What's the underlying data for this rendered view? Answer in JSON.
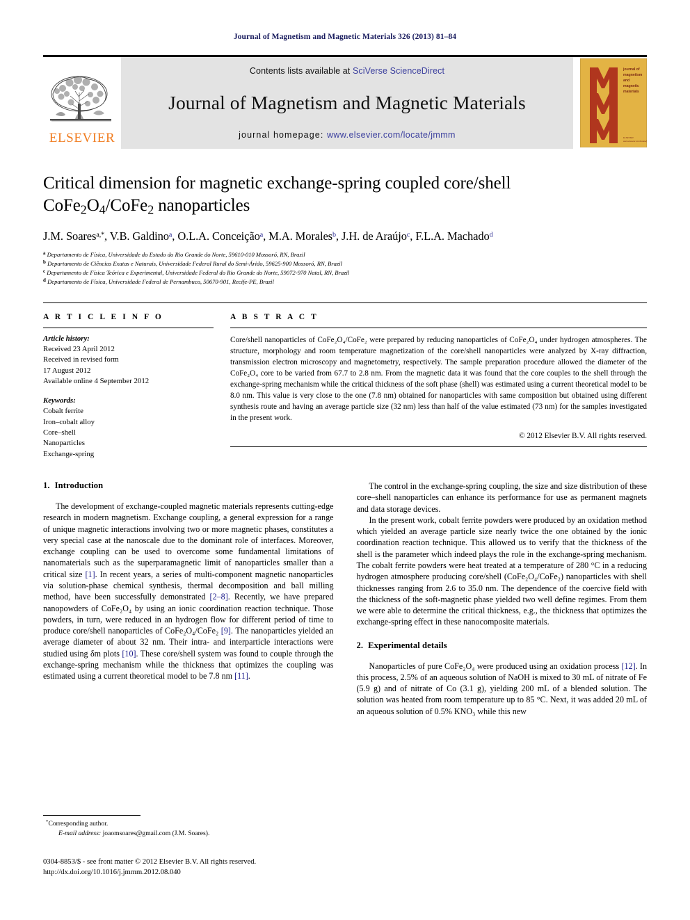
{
  "running_head": "Journal of Magnetism and Magnetic Materials 326 (2013) 81–84",
  "masthead": {
    "publisher_name": "ELSEVIER",
    "publisher_logo_icon": "elsevier-tree-icon",
    "contents_prefix": "Contents lists available at ",
    "contents_link": "SciVerse ScienceDirect",
    "journal_name": "Journal of Magnetism and Magnetic Materials",
    "homepage_prefix": "journal homepage: ",
    "homepage_url": "www.elsevier.com/locate/jmmm",
    "cover": {
      "letters": [
        "M",
        "M",
        "M"
      ],
      "caption_lines": [
        "journal of",
        "magnetism",
        "and",
        "magnetic",
        "materials"
      ],
      "bg_color": "#e3b344",
      "letter_color": "#b0361e"
    },
    "banner_bg": "#e3e3e3",
    "link_color": "#3b3f9e",
    "elsevier_orange": "#f07c1f"
  },
  "title": {
    "line1": "Critical dimension for magnetic exchange-spring coupled core/shell",
    "line2_pre": "CoFe",
    "line2_sub1": "2",
    "line2_mid": "O",
    "line2_sub2": "4",
    "line2_slash": "/CoFe",
    "line2_sub3": "2",
    "line2_post": " nanoparticles"
  },
  "authors": [
    {
      "name": "J.M. Soares",
      "marks": "a,*"
    },
    {
      "name": "V.B. Galdino",
      "marks": "a"
    },
    {
      "name": "O.L.A. Conceição",
      "marks": "a"
    },
    {
      "name": "M.A. Morales",
      "marks": "b"
    },
    {
      "name": "J.H. de Araújo",
      "marks": "c"
    },
    {
      "name": "F.L.A. Machado",
      "marks": "d"
    }
  ],
  "affiliations": [
    {
      "mark": "a",
      "text": "Departamento de Física, Universidade do Estado do Rio Grande do Norte, 59610-010 Mossoró, RN, Brazil"
    },
    {
      "mark": "b",
      "text": "Departamento de Ciências Exatas e Naturais, Universidade Federal Rural do Semi-Árido, 59625-900 Mossoró, RN, Brazil"
    },
    {
      "mark": "c",
      "text": "Departamento de Física Teórica e Experimental, Universidade Federal do Rio Grande do Norte, 59072-970 Natal, RN, Brazil"
    },
    {
      "mark": "d",
      "text": "Departamento de Física, Universidade Federal de Pernambuco, 50670-901, Recife-PE, Brazil"
    }
  ],
  "article_info": {
    "heading": "A R T I C L E   I N F O",
    "history_label": "Article history:",
    "history": [
      "Received 23 April 2012",
      "Received in revised form",
      "17 August 2012",
      "Available online 4 September 2012"
    ],
    "keywords_label": "Keywords:",
    "keywords": [
      "Cobalt ferrite",
      "Iron–cobalt alloy",
      "Core–shell",
      "Nanoparticles",
      "Exchange-spring"
    ]
  },
  "abstract": {
    "heading": "A B S T R A C T",
    "text": "Core/shell nanoparticles of CoFe₂O₄/CoFe₂ were prepared by reducing nanoparticles of CoFe₂O₄ under hydrogen atmospheres. The structure, morphology and room temperature magnetization of the core/shell nanoparticles were analyzed by X-ray diffraction, transmission electron microscopy and magnetometry, respectively. The sample preparation procedure allowed the diameter of the CoFe₂O₄ core to be varied from 67.7 to 2.8 nm. From the magnetic data it was found that the core couples to the shell through the exchange-spring mechanism while the critical thickness of the soft phase (shell) was estimated using a current theoretical model to be 8.0 nm. This value is very close to the one (7.8 nm) obtained for nanoparticles with same composition but obtained using different synthesis route and having an average particle size (32 nm) less than half of the value estimated (73 nm) for the samples investigated in the present work.",
    "copyright": "© 2012 Elsevier B.V. All rights reserved."
  },
  "sections": {
    "introduction": {
      "number": "1.",
      "title": "Introduction",
      "paragraphs": [
        "The development of exchange-coupled magnetic materials represents cutting-edge research in modern magnetism. Exchange coupling, a general expression for a range of unique magnetic interactions involving two or more magnetic phases, constitutes a very special case at the nanoscale due to the dominant role of interfaces. Moreover, exchange coupling can be used to overcome some fundamental limitations of nanomaterials such as the superparamagnetic limit of nanoparticles smaller than a critical size [1]. In recent years, a series of multi-component magnetic nanoparticles via solution-phase chemical synthesis, thermal decomposition and ball milling method, have been successfully demonstrated [2–8]. Recently, we have prepared nanopowders of CoFe₂O₄ by using an ionic coordination reaction technique. Those powders, in turn, were reduced in an hydrogen flow for different period of time to produce core/shell nanoparticles of CoFe₂O₄/CoFe₂ [9]. The nanoparticles yielded an average diameter of about 32 nm. Their intra- and interparticle interactions were studied using δm plots [10]. These core/shell system was found to couple through the exchange-spring mechanism while the thickness that optimizes the coupling was estimated using a current theoretical model to be 7.8 nm [11].",
        "The control in the exchange-spring coupling, the size and size distribution of these core–shell nanoparticles can enhance its performance for use as permanent magnets and data storage devices.",
        "In the present work, cobalt ferrite powders were produced by an oxidation method which yielded an average particle size nearly twice the one obtained by the ionic coordination reaction technique. This allowed us to verify that the thickness of the shell is the parameter which indeed plays the role in the exchange-spring mechanism. The cobalt ferrite powders were heat treated at a temperature of 280 °C in a reducing hydrogen atmosphere producing core/shell (CoFe₂O₄/CoFe₂) nanoparticles with shell thicknesses ranging from 2.6 to 35.0 nm. The dependence of the coercive field with the thickness of the soft-magnetic phase yielded two well define regimes. From them we were able to determine the critical thickness, e.g., the thickness that optimizes the exchange-spring effect in these nanocomposite materials."
      ]
    },
    "experimental": {
      "number": "2.",
      "title": "Experimental details",
      "paragraphs": [
        "Nanoparticles of pure CoFe₂O₄ were produced using an oxidation process [12]. In this process, 2.5% of an aqueous solution of NaOH is mixed to 30 mL of nitrate of Fe (5.9 g) and of nitrate of Co (3.1 g), yielding 200 mL of a blended solution. The solution was heated from room temperature up to 85 °C. Next, it was added 20 mL of an aqueous solution of 0.5% KNO₃ while this new"
      ]
    }
  },
  "footnotes": {
    "corresponding": "Corresponding author.",
    "email_label": "E-mail address:",
    "email": "joaomsoares@gmail.com (J.M. Soares)."
  },
  "imprint": {
    "line1": "0304-8853/$ - see front matter © 2012 Elsevier B.V. All rights reserved.",
    "line2": "http://dx.doi.org/10.1016/j.jmmm.2012.08.040"
  }
}
